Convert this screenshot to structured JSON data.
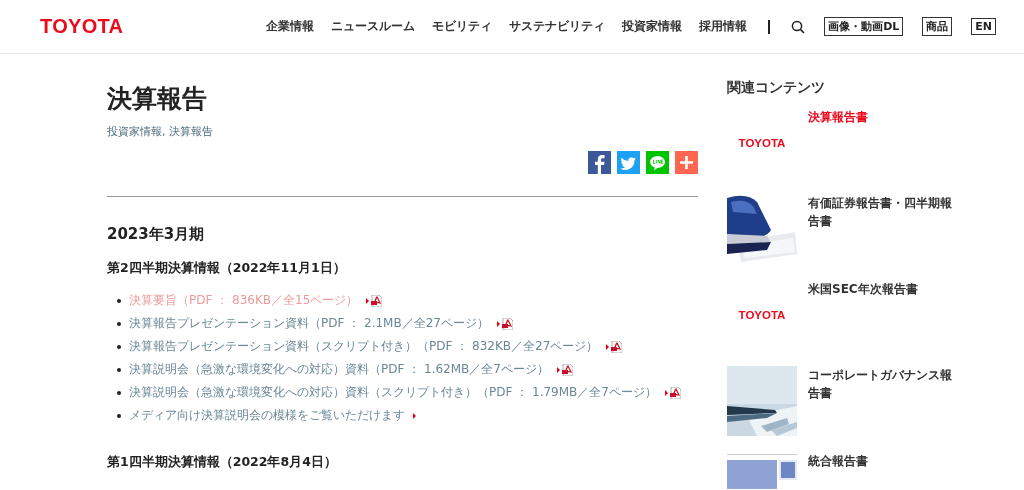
{
  "header": {
    "logo": "TOYOTA",
    "nav": [
      "企業情報",
      "ニュースルーム",
      "モビリティ",
      "サステナビリティ",
      "投資家情報",
      "採用情報"
    ],
    "buttons": [
      "画像・動画DL",
      "商品",
      "EN"
    ]
  },
  "main": {
    "title": "決算報告",
    "breadcrumb": "投資家情報, 決算報告",
    "share": [
      {
        "kind": "facebook"
      },
      {
        "kind": "twitter"
      },
      {
        "kind": "line"
      },
      {
        "kind": "plus"
      }
    ],
    "period": "2023年3月期",
    "groups": [
      {
        "heading": "第2四半期決算情報（2022年11月1日）",
        "items": [
          {
            "text": "決算要旨（PDF ： 836KB／全15ページ）",
            "highlighted": true,
            "pdf": true
          },
          {
            "text": "決算報告プレゼンテーション資料（PDF ： 2.1MB／全27ページ）",
            "highlighted": false,
            "pdf": true
          },
          {
            "text": "決算報告プレゼンテーション資料（スクリプト付き）（PDF ： 832KB／全27ページ）",
            "highlighted": false,
            "pdf": true
          },
          {
            "text": "決算説明会（急激な環境変化への対応）資料（PDF ： 1.62MB／全7ページ）",
            "highlighted": false,
            "pdf": true
          },
          {
            "text": "決算説明会（急激な環境変化への対応）資料（スクリプト付き）（PDF ： 1.79MB／全7ページ）",
            "highlighted": false,
            "pdf": true
          },
          {
            "text": "メディア向け決算説明会の模様をご覧いただけます",
            "highlighted": false,
            "pdf": false
          }
        ]
      },
      {
        "heading": "第1四半期決算情報（2022年8月4日）"
      }
    ]
  },
  "sidebar": {
    "heading": "関連コンテンツ",
    "items": [
      {
        "title": "決算報告書",
        "selected": true,
        "thumb": {
          "kind": "logo",
          "text": "TOYOTA"
        }
      },
      {
        "title": "有価証券報告書・四半期報告書",
        "selected": false,
        "thumb": {
          "kind": "stapler"
        }
      },
      {
        "title": "米国SEC年次報告書",
        "selected": false,
        "thumb": {
          "kind": "logo",
          "text": "TOYOTA"
        }
      },
      {
        "title": "コーポレートガバナンス報告書",
        "selected": false,
        "thumb": {
          "kind": "pen"
        }
      },
      {
        "title": "統合報告書",
        "selected": false,
        "thumb": {
          "kind": "cover"
        }
      }
    ]
  }
}
